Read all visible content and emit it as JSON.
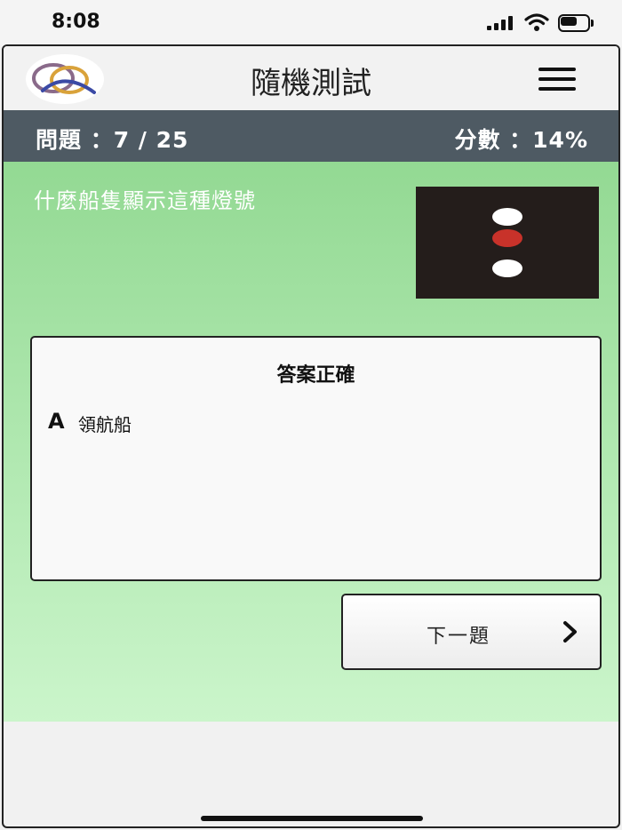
{
  "status_bar": {
    "time": "8:08",
    "icons": [
      "signal-icon",
      "wifi-icon",
      "battery-icon"
    ]
  },
  "header": {
    "title": "隨機測試",
    "logo_icon": "logo-icon",
    "menu_icon": "hamburger-menu-icon"
  },
  "info_bar": {
    "question_counter": "問題 ：7 / 25",
    "score": "分數 ：14%",
    "background_color": "#4e5a63"
  },
  "question": {
    "text": "什麼船隻顯示這種燈號",
    "lights": [
      "#ffffff",
      "#c8322a",
      "#ffffff"
    ],
    "image_background": "#241d1b"
  },
  "answer_panel": {
    "heading": "答案正確",
    "letter": "A",
    "text": "領航船"
  },
  "next_button": {
    "label": "下一題",
    "icon": "chevron-right-icon"
  },
  "colors": {
    "gradient_top": "#93d993",
    "gradient_bottom": "#cbf5cb"
  }
}
